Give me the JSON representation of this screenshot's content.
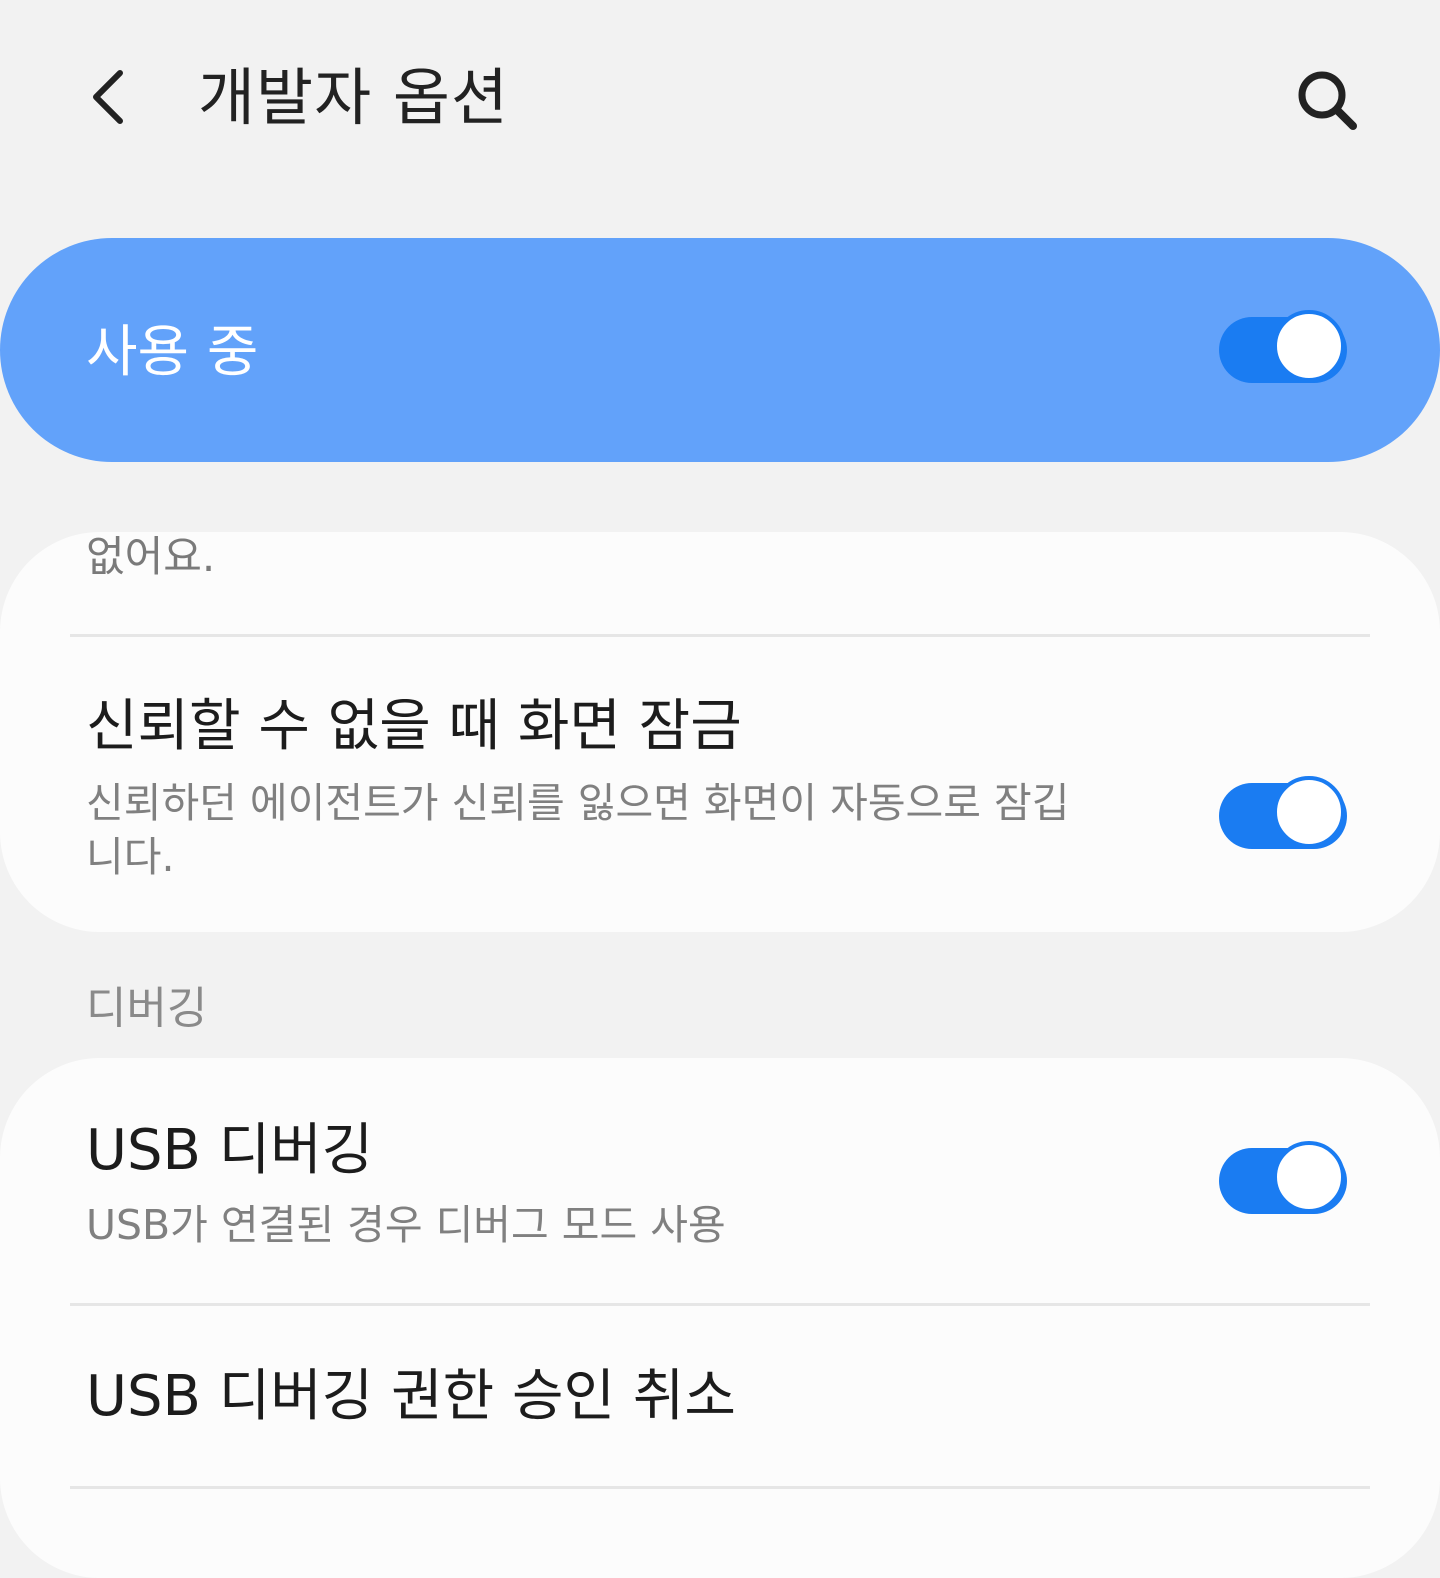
{
  "header": {
    "title": "개발자 옵션",
    "back_icon": "chevron-left-icon",
    "search_icon": "search-icon"
  },
  "master_switch": {
    "label": "사용 중",
    "on": true,
    "accent_color": "#62a2fa"
  },
  "card_1": {
    "fragment_text": "없어요.",
    "items": [
      {
        "title": "신뢰할 수 없을 때 화면 잠금",
        "description": "신뢰하던 에이전트가 신뢰를 잃으면 화면이 자동으로 잠깁니다.",
        "on": true
      }
    ]
  },
  "section_debugging": {
    "header": "디버깅"
  },
  "card_2": {
    "items": [
      {
        "title": "USB 디버깅",
        "description": "USB가 연결된 경우 디버그 모드 사용",
        "on": true
      },
      {
        "title": "USB 디버깅 권한 승인 취소"
      }
    ]
  },
  "colors": {
    "background": "#f2f2f2",
    "card": "#fcfcfc",
    "switch_on": "#1a7cf2"
  }
}
